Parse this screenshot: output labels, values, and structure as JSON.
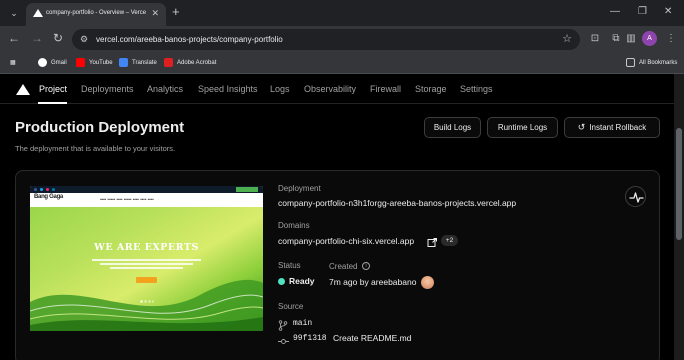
{
  "browser": {
    "tab_title": "company-portfolio - Overview – Vercel",
    "url": "vercel.com/areeba-banos-projects/company-portfolio",
    "profile_initial": "A",
    "bookmarks": [
      "Gmail",
      "YouTube",
      "Translate",
      "Adobe Acrobat"
    ],
    "all_bookmarks": "All Bookmarks"
  },
  "nav": {
    "tabs": [
      "Project",
      "Deployments",
      "Analytics",
      "Speed Insights",
      "Logs",
      "Observability",
      "Firewall",
      "Storage",
      "Settings"
    ],
    "active_tab": "Project"
  },
  "header": {
    "title": "Production Deployment",
    "subtitle": "The deployment that is available to your visitors.",
    "buttons": {
      "build_logs": "Build Logs",
      "runtime_logs": "Runtime Logs",
      "instant_rollback": "Instant Rollback"
    }
  },
  "preview": {
    "logo": "Bang Gaga",
    "heading": "WE ARE EXPERTS"
  },
  "deployment": {
    "deployment_label": "Deployment",
    "deployment_url": "company-portfolio-n3h1forgg-areeba-banos-projects.vercel.app",
    "domains_label": "Domains",
    "domain": "company-portfolio-chi-six.vercel.app",
    "extra_domains": "+2",
    "status_label": "Status",
    "status": "Ready",
    "created_label": "Created",
    "created_value": "7m ago by areebabano",
    "source_label": "Source",
    "branch": "main",
    "commit_hash": "99f1318",
    "commit_message": "Create README.md"
  },
  "colors": {
    "ready": "#50e3c2",
    "accent": "#ffffff",
    "background": "#000000"
  }
}
